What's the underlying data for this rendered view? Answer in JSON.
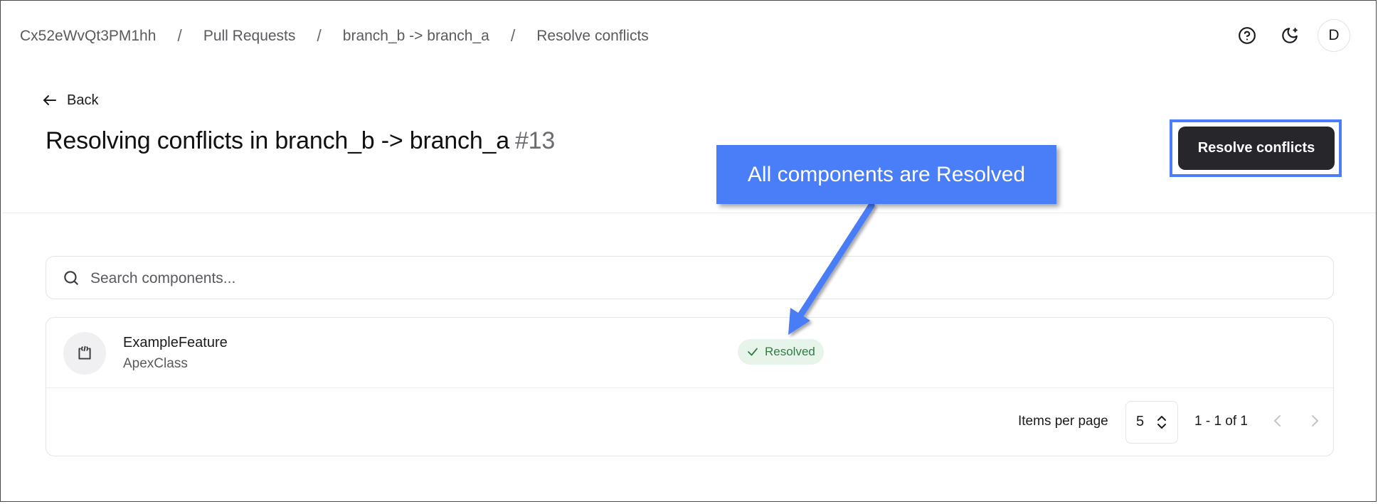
{
  "breadcrumb": {
    "items": [
      "Cx52eWvQt3PM1hh",
      "Pull Requests",
      "branch_b -> branch_a",
      "Resolve conflicts"
    ],
    "separator": "/"
  },
  "header": {
    "help_icon": "help-circle-icon",
    "theme_icon": "moon-icon",
    "avatar_initial": "D"
  },
  "page": {
    "back_label": "Back",
    "title": "Resolving conflicts in branch_b -> branch_a",
    "pr_number": "#13",
    "resolve_button": "Resolve conflicts"
  },
  "search": {
    "placeholder": "Search components..."
  },
  "components": [
    {
      "name": "ExampleFeature",
      "type": "ApexClass",
      "status": "Resolved"
    }
  ],
  "pagination": {
    "items_per_page_label": "Items per page",
    "items_per_page": "5",
    "range": "1 - 1 of 1"
  },
  "annotation": {
    "text": "All components are Resolved"
  },
  "colors": {
    "accent": "#4a7df8",
    "button_dark": "#26262b",
    "resolved_bg": "#e6f4e9",
    "resolved_text": "#2f7d45"
  }
}
